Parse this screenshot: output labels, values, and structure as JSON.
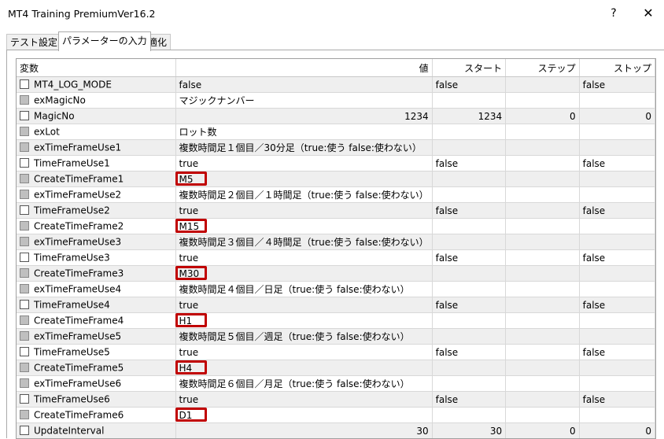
{
  "window": {
    "title": "MT4 Training PremiumVer16.2",
    "help_label": "?",
    "close_label": "✕"
  },
  "tabs": [
    {
      "label": "テスト設定",
      "active": false
    },
    {
      "label": "パラメーターの入力",
      "active": true
    },
    {
      "label": "最適化",
      "active": false
    }
  ],
  "columns": [
    "変数",
    "値",
    "スタート",
    "ステップ",
    "ストップ"
  ],
  "rows": [
    {
      "name": "MT4_LOG_MODE",
      "checkbox": "white",
      "value": "false",
      "start": "false",
      "step": "",
      "stop": "false",
      "numeric": false,
      "highlight": false
    },
    {
      "name": "exMagicNo",
      "checkbox": "gray",
      "value": "マジックナンバー",
      "start": "",
      "step": "",
      "stop": "",
      "numeric": false,
      "highlight": false
    },
    {
      "name": "MagicNo",
      "checkbox": "white",
      "value": "1234",
      "start": "1234",
      "step": "0",
      "stop": "0",
      "numeric": true,
      "highlight": false
    },
    {
      "name": "exLot",
      "checkbox": "gray",
      "value": "ロット数",
      "start": "",
      "step": "",
      "stop": "",
      "numeric": false,
      "highlight": false
    },
    {
      "name": "exTimeFrameUse1",
      "checkbox": "gray",
      "value": "複数時間足１個目／30分足（true:使う false:使わない）",
      "start": "",
      "step": "",
      "stop": "",
      "numeric": false,
      "highlight": false
    },
    {
      "name": "TimeFrameUse1",
      "checkbox": "white",
      "value": "true",
      "start": "false",
      "step": "",
      "stop": "false",
      "numeric": false,
      "highlight": false
    },
    {
      "name": "CreateTimeFrame1",
      "checkbox": "gray",
      "value": "M5",
      "start": "",
      "step": "",
      "stop": "",
      "numeric": false,
      "highlight": true
    },
    {
      "name": "exTimeFrameUse2",
      "checkbox": "gray",
      "value": "複数時間足２個目／１時間足（true:使う false:使わない）",
      "start": "",
      "step": "",
      "stop": "",
      "numeric": false,
      "highlight": false
    },
    {
      "name": "TimeFrameUse2",
      "checkbox": "white",
      "value": "true",
      "start": "false",
      "step": "",
      "stop": "false",
      "numeric": false,
      "highlight": false
    },
    {
      "name": "CreateTimeFrame2",
      "checkbox": "gray",
      "value": "M15",
      "start": "",
      "step": "",
      "stop": "",
      "numeric": false,
      "highlight": true
    },
    {
      "name": "exTimeFrameUse3",
      "checkbox": "gray",
      "value": "複数時間足３個目／４時間足（true:使う false:使わない）",
      "start": "",
      "step": "",
      "stop": "",
      "numeric": false,
      "highlight": false
    },
    {
      "name": "TimeFrameUse3",
      "checkbox": "white",
      "value": "true",
      "start": "false",
      "step": "",
      "stop": "false",
      "numeric": false,
      "highlight": false
    },
    {
      "name": "CreateTimeFrame3",
      "checkbox": "gray",
      "value": "M30",
      "start": "",
      "step": "",
      "stop": "",
      "numeric": false,
      "highlight": true
    },
    {
      "name": "exTimeFrameUse4",
      "checkbox": "gray",
      "value": "複数時間足４個目／日足（true:使う false:使わない）",
      "start": "",
      "step": "",
      "stop": "",
      "numeric": false,
      "highlight": false
    },
    {
      "name": "TimeFrameUse4",
      "checkbox": "white",
      "value": "true",
      "start": "false",
      "step": "",
      "stop": "false",
      "numeric": false,
      "highlight": false
    },
    {
      "name": "CreateTimeFrame4",
      "checkbox": "gray",
      "value": "H1",
      "start": "",
      "step": "",
      "stop": "",
      "numeric": false,
      "highlight": true
    },
    {
      "name": "exTimeFrameUse5",
      "checkbox": "gray",
      "value": "複数時間足５個目／週足（true:使う false:使わない）",
      "start": "",
      "step": "",
      "stop": "",
      "numeric": false,
      "highlight": false
    },
    {
      "name": "TimeFrameUse5",
      "checkbox": "white",
      "value": "true",
      "start": "false",
      "step": "",
      "stop": "false",
      "numeric": false,
      "highlight": false
    },
    {
      "name": "CreateTimeFrame5",
      "checkbox": "gray",
      "value": "H4",
      "start": "",
      "step": "",
      "stop": "",
      "numeric": false,
      "highlight": true
    },
    {
      "name": "exTimeFrameUse6",
      "checkbox": "gray",
      "value": "複数時間足６個目／月足（true:使う false:使わない）",
      "start": "",
      "step": "",
      "stop": "",
      "numeric": false,
      "highlight": false
    },
    {
      "name": "TimeFrameUse6",
      "checkbox": "white",
      "value": "true",
      "start": "false",
      "step": "",
      "stop": "false",
      "numeric": false,
      "highlight": false
    },
    {
      "name": "CreateTimeFrame6",
      "checkbox": "gray",
      "value": "D1",
      "start": "",
      "step": "",
      "stop": "",
      "numeric": false,
      "highlight": true
    },
    {
      "name": "UpdateInterval",
      "checkbox": "white",
      "value": "30",
      "start": "30",
      "step": "0",
      "stop": "0",
      "numeric": true,
      "highlight": false
    }
  ],
  "colors": {
    "highlight_border": "#c00000",
    "alt_row": "#efefef",
    "grid_line": "#d8d8d8"
  }
}
